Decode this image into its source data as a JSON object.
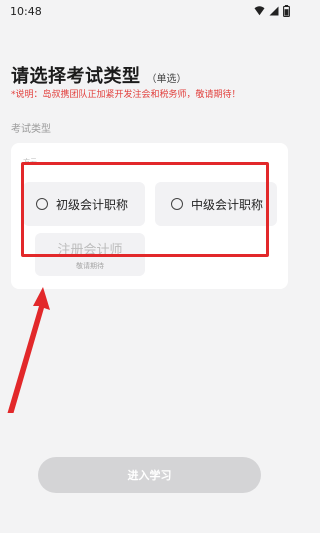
{
  "status_bar": {
    "time": "10:48"
  },
  "header": {
    "title": "请选择考试类型",
    "title_note": "（单选）",
    "notice": "*说明：岛叔携团队正加紧开发注会和税务师，敬请期待！"
  },
  "section": {
    "label": "考试类型",
    "card_tag": "方云",
    "options": [
      {
        "label": "初级会计职称",
        "selected": false,
        "enabled": true
      },
      {
        "label": "中级会计职称",
        "selected": false,
        "enabled": true
      },
      {
        "label": "注册会计师",
        "sublabel": "敬请期待",
        "enabled": false
      }
    ]
  },
  "footer": {
    "submit_label": "进入学习"
  },
  "annotation": {
    "highlight_color": "#e2282a",
    "arrow_color": "#e2282a"
  }
}
